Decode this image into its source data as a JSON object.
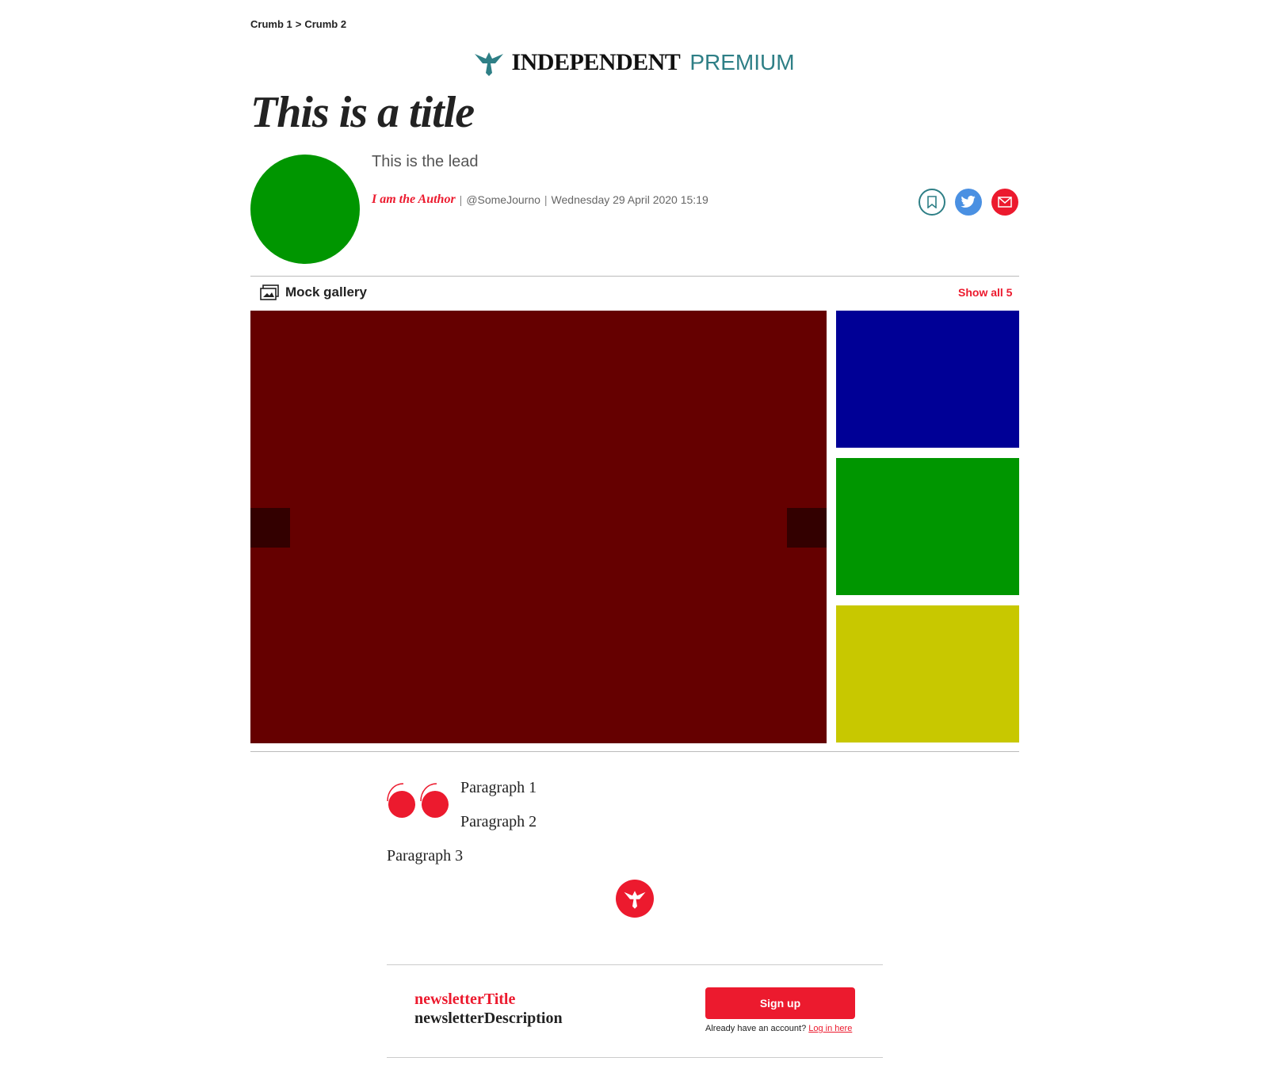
{
  "breadcrumb": {
    "items": [
      "Crumb 1",
      "Crumb 2"
    ],
    "separator": ">"
  },
  "masthead": {
    "brand": "INDEPENDENT",
    "tier": "PREMIUM"
  },
  "article": {
    "title": "This is a title",
    "lead": "This is the lead",
    "author": "I am the Author",
    "twitter_handle": "@SomeJourno",
    "date": "Wednesday 29 April 2020 15:19",
    "paragraphs": [
      "Paragraph 1",
      "Paragraph 2",
      "Paragraph 3"
    ]
  },
  "gallery": {
    "label": "Mock gallery",
    "show_all": "Show all 5",
    "main_color": "#650000",
    "thumbs": [
      {
        "color": "#000096"
      },
      {
        "color": "#009600"
      },
      {
        "color": "#c8c800"
      }
    ]
  },
  "newsletter": {
    "title": "newsletterTitle",
    "description": "newsletterDescription",
    "signup_label": "Sign up",
    "login_prompt": "Already have an account?",
    "login_link": "Log in here"
  },
  "colors": {
    "accent_red": "#ec1a2e",
    "premium_teal": "#2e7f86",
    "avatar_green": "#009600",
    "twitter_blue": "#4a90e2"
  },
  "icons": [
    "eagle-logo-icon",
    "bookmark-icon",
    "twitter-icon",
    "email-icon",
    "gallery-icon",
    "quote-icon",
    "eagle-badge-icon"
  ]
}
